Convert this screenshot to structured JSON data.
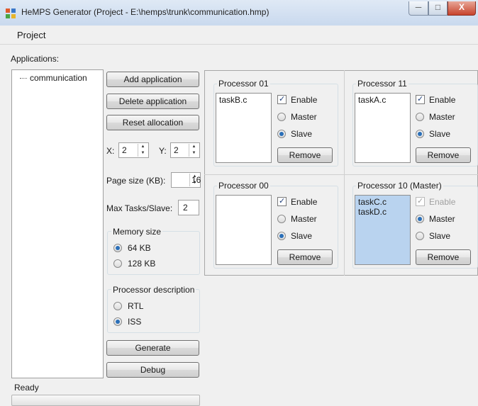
{
  "window": {
    "title": "HeMPS Generator (Project - E:\\hemps\\trunk\\communication.hmp)",
    "min_icon": "minimize-icon",
    "max_icon": "maximize-icon",
    "close_icon": "close-icon",
    "close_glyph": "X"
  },
  "menu": {
    "project": "Project"
  },
  "applications": {
    "label": "Applications:",
    "items": [
      "communication"
    ]
  },
  "buttons": {
    "add_application": "Add application",
    "delete_application": "Delete application",
    "reset_allocation": "Reset allocation",
    "generate": "Generate",
    "debug": "Debug"
  },
  "settings": {
    "x_label": "X:",
    "x_value": "2",
    "y_label": "Y:",
    "y_value": "2",
    "page_size_label": "Page size (KB):",
    "page_size_value": "16",
    "max_tasks_label": "Max Tasks/Slave:",
    "max_tasks_value": "2"
  },
  "memory": {
    "title": "Memory size",
    "options": [
      {
        "label": "64 KB",
        "selected": true
      },
      {
        "label": "128 KB",
        "selected": false
      }
    ]
  },
  "processor_description": {
    "title": "Processor description",
    "options": [
      {
        "label": "RTL",
        "selected": false
      },
      {
        "label": "ISS",
        "selected": true
      }
    ]
  },
  "processors": [
    {
      "title": "Processor 01",
      "tasks": [
        "taskB.c"
      ],
      "enable_label": "Enable",
      "enable": true,
      "enable_disabled": false,
      "master_label": "Master",
      "slave_label": "Slave",
      "role": "slave",
      "remove_label": "Remove",
      "list_selected": false
    },
    {
      "title": "Processor 11",
      "tasks": [
        "taskA.c"
      ],
      "enable_label": "Enable",
      "enable": true,
      "enable_disabled": false,
      "master_label": "Master",
      "slave_label": "Slave",
      "role": "slave",
      "remove_label": "Remove",
      "list_selected": false
    },
    {
      "title": "Processor 00",
      "tasks": [],
      "enable_label": "Enable",
      "enable": true,
      "enable_disabled": false,
      "master_label": "Master",
      "slave_label": "Slave",
      "role": "slave",
      "remove_label": "Remove",
      "list_selected": false
    },
    {
      "title": "Processor 10 (Master)",
      "tasks": [
        "taskC.c",
        "taskD.c"
      ],
      "enable_label": "Enable",
      "enable": true,
      "enable_disabled": true,
      "master_label": "Master",
      "slave_label": "Slave",
      "role": "master",
      "remove_label": "Remove",
      "list_selected": true
    }
  ],
  "status": {
    "text": "Ready"
  }
}
